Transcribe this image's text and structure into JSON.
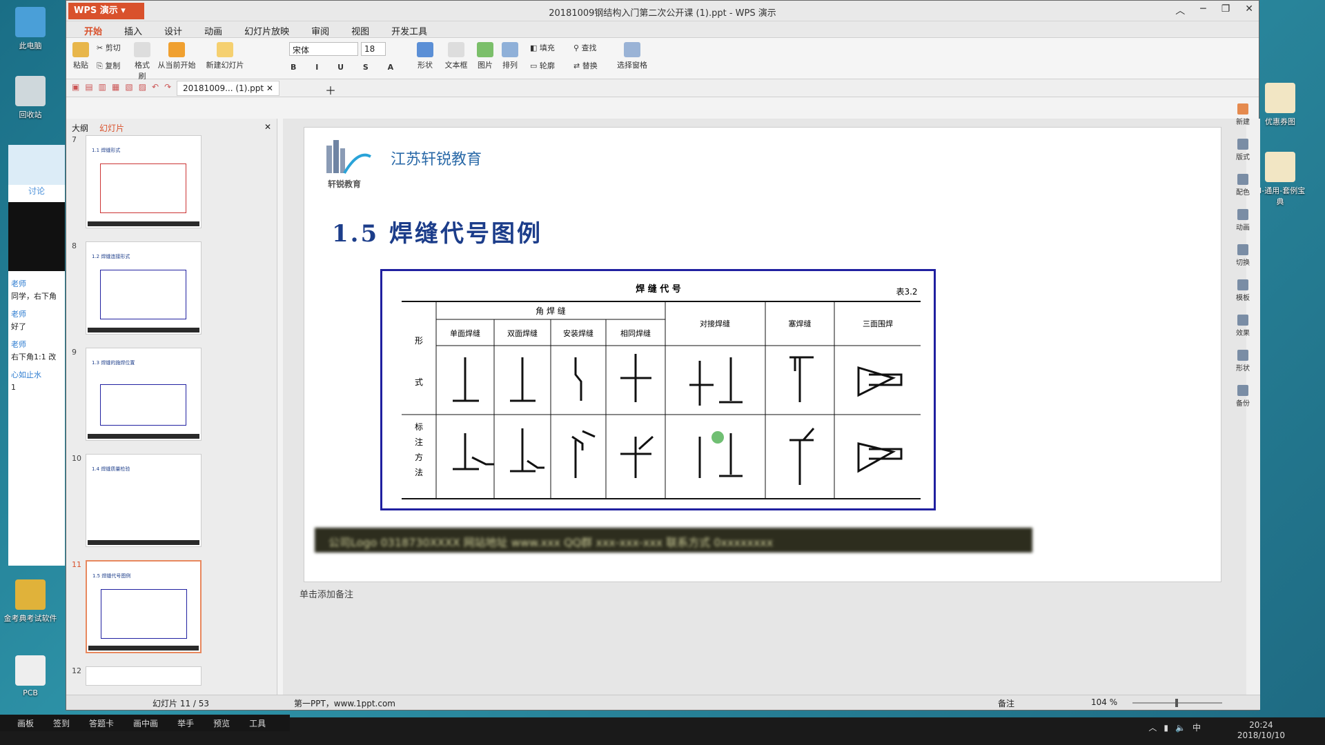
{
  "desktop": {
    "icons": [
      {
        "label": "此电脑"
      },
      {
        "label": "回收站"
      },
      {
        "label": "金考典考试软件"
      },
      {
        "label": "PCB"
      },
      {
        "label": "优惠券图"
      },
      {
        "label": "M-通用-套例宝典"
      }
    ]
  },
  "chat": {
    "tab": "讨论",
    "items": [
      {
        "name": "老师",
        "text": "同学，右下角"
      },
      {
        "name": "老师",
        "text": "好了"
      },
      {
        "name": "老师",
        "text": "右下角1:1 改"
      },
      {
        "name": "心如止水",
        "text": "1"
      }
    ]
  },
  "window": {
    "app_button": "WPS 演示",
    "title": "20181009钢结构入门第二次公开课 (1).ppt - WPS 演示"
  },
  "menu": {
    "items": [
      "开始",
      "插入",
      "设计",
      "动画",
      "幻灯片放映",
      "审阅",
      "视图",
      "开发工具"
    ],
    "active": "开始"
  },
  "ribbon": {
    "paste": "粘贴",
    "cut": "剪切",
    "copy": "复制",
    "format_painter": "格式刷",
    "from_start": "从当前开始",
    "new_slide": "新建幻灯片",
    "font": "宋体",
    "size": "18",
    "shape": "形状",
    "textbox": "文本框",
    "picture": "图片",
    "arrange": "排列",
    "fill": "填充",
    "outline": "轮廓",
    "find": "查找",
    "replace": "替换",
    "select_pane": "选择窗格"
  },
  "file_tab": {
    "name": "20181009... (1).ppt"
  },
  "left": {
    "tab_outline": "大纲",
    "tab_slides": "幻灯片",
    "thumbs": [
      {
        "num": "7",
        "title": "1.1 焊缝形式"
      },
      {
        "num": "8",
        "title": "1.2 焊缝连接形式"
      },
      {
        "num": "9",
        "title": "1.3 焊缝的施焊位置"
      },
      {
        "num": "10",
        "title": "1.4 焊缝质量检验"
      },
      {
        "num": "11",
        "title": "1.5 焊缝代号图例"
      },
      {
        "num": "12",
        "title": ""
      }
    ]
  },
  "slide": {
    "brand": "江苏轩锐教育",
    "logo_text": "轩锐教育",
    "title": "1.5  焊缝代号图例",
    "table": {
      "caption": "焊 缝 代 号",
      "table_no": "表3.2",
      "group_fillet": "角   焊   缝",
      "cols": [
        "单面焊缝",
        "双面焊缝",
        "安装焊缝",
        "相同焊缝",
        "对接焊缝",
        "塞焊缝",
        "三面围焊"
      ],
      "row_form": [
        "形",
        "式"
      ],
      "row_mark": [
        "标",
        "注",
        "方",
        "法"
      ]
    },
    "footer_blur": "公司Logo  0318730XXXX  网站地址  www.xxx  QQ群  xxx-xxx-xxx  联系方式  0xxxxxxxx"
  },
  "notes": "单击添加备注",
  "status": {
    "slide_info": "幻灯片 11 / 53",
    "theme": "第一PPT，www.1ppt.com",
    "notes_btn": "备注",
    "zoom": "104 %"
  },
  "taskpane": [
    "新建",
    "版式",
    "配色",
    "动画",
    "切换",
    "模板",
    "效果",
    "形状",
    "备份"
  ],
  "bottombar": [
    "画板",
    "签到",
    "答题卡",
    "画中画",
    "举手",
    "预览",
    "工具"
  ],
  "clock": {
    "time": "20:24",
    "date": "2018/10/10"
  },
  "colors": {
    "accent": "#d9512c",
    "title": "#1c3d8a",
    "table_border": "#2020a0"
  }
}
